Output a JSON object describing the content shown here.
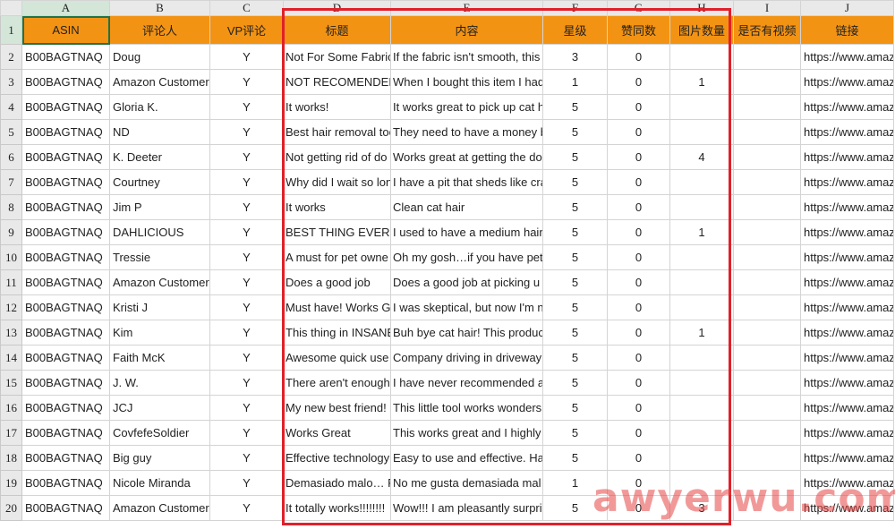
{
  "column_letters": [
    "A",
    "B",
    "C",
    "D",
    "E",
    "F",
    "G",
    "H",
    "I",
    "J"
  ],
  "headers": [
    "ASIN",
    "评论人",
    "VP评论",
    "标题",
    "内容",
    "星级",
    "赞同数",
    "图片数量",
    "是否有视频",
    "链接"
  ],
  "rows": [
    {
      "row": "2",
      "asin": "B00BAGTNAQ",
      "reviewer": "Doug",
      "vp": "Y",
      "title": "Not For Some Fabric",
      "content": "If the fabric isn't smooth, this",
      "stars": "3",
      "likes": "0",
      "images": "",
      "video": "",
      "link": "https://www.amaz"
    },
    {
      "row": "3",
      "asin": "B00BAGTNAQ",
      "reviewer": "Amazon Customer",
      "vp": "Y",
      "title": "NOT RECOMENDED",
      "content": "When I bought this item I had",
      "stars": "1",
      "likes": "0",
      "images": "1",
      "video": "",
      "link": "https://www.amaz"
    },
    {
      "row": "4",
      "asin": "B00BAGTNAQ",
      "reviewer": "Gloria K.",
      "vp": "Y",
      "title": "It works!",
      "content": "It works great to pick up cat h",
      "stars": "5",
      "likes": "0",
      "images": "",
      "video": "",
      "link": "https://www.amaz"
    },
    {
      "row": "5",
      "asin": "B00BAGTNAQ",
      "reviewer": "ND",
      "vp": "Y",
      "title": "Best hair removal too",
      "content": "They need to have a money b",
      "stars": "5",
      "likes": "0",
      "images": "",
      "video": "",
      "link": "https://www.amaz"
    },
    {
      "row": "6",
      "asin": "B00BAGTNAQ",
      "reviewer": "K. Deeter",
      "vp": "Y",
      "title": "Not getting rid of do",
      "content": "Works great at getting the do",
      "stars": "5",
      "likes": "0",
      "images": "4",
      "video": "",
      "link": "https://www.amaz"
    },
    {
      "row": "7",
      "asin": "B00BAGTNAQ",
      "reviewer": "Courtney",
      "vp": "Y",
      "title": "Why did I wait so lon",
      "content": "I have a pit that sheds like cra",
      "stars": "5",
      "likes": "0",
      "images": "",
      "video": "",
      "link": "https://www.amaz"
    },
    {
      "row": "8",
      "asin": "B00BAGTNAQ",
      "reviewer": "Jim P",
      "vp": "Y",
      "title": "It works",
      "content": "Clean cat hair",
      "stars": "5",
      "likes": "0",
      "images": "",
      "video": "",
      "link": "https://www.amaz"
    },
    {
      "row": "9",
      "asin": "B00BAGTNAQ",
      "reviewer": "DAHLICIOUS",
      "vp": "Y",
      "title": "BEST THING EVER &",
      "content": "I used to have a medium hair",
      "stars": "5",
      "likes": "0",
      "images": "1",
      "video": "",
      "link": "https://www.amaz"
    },
    {
      "row": "10",
      "asin": "B00BAGTNAQ",
      "reviewer": "Tressie",
      "vp": "Y",
      "title": "A must for pet owne",
      "content": "Oh my gosh…if you have pet",
      "stars": "5",
      "likes": "0",
      "images": "",
      "video": "",
      "link": "https://www.amaz"
    },
    {
      "row": "11",
      "asin": "B00BAGTNAQ",
      "reviewer": "Amazon Customer",
      "vp": "Y",
      "title": "Does a good job",
      "content": "Does a good job at picking u",
      "stars": "5",
      "likes": "0",
      "images": "",
      "video": "",
      "link": "https://www.amaz"
    },
    {
      "row": "12",
      "asin": "B00BAGTNAQ",
      "reviewer": "Kristi J",
      "vp": "Y",
      "title": "Must have! Works Gr",
      "content": "I was skeptical, but now I'm n",
      "stars": "5",
      "likes": "0",
      "images": "",
      "video": "",
      "link": "https://www.amaz"
    },
    {
      "row": "13",
      "asin": "B00BAGTNAQ",
      "reviewer": "Kim",
      "vp": "Y",
      "title": "This thing in INSANE",
      "content": "Buh bye cat hair! This produc",
      "stars": "5",
      "likes": "0",
      "images": "1",
      "video": "",
      "link": "https://www.amaz"
    },
    {
      "row": "14",
      "asin": "B00BAGTNAQ",
      "reviewer": "Faith McK",
      "vp": "Y",
      "title": "Awesome quick use",
      "content": "Company driving in driveway",
      "stars": "5",
      "likes": "0",
      "images": "",
      "video": "",
      "link": "https://www.amaz"
    },
    {
      "row": "15",
      "asin": "B00BAGTNAQ",
      "reviewer": "J. W.",
      "vp": "Y",
      "title": "There aren't enough",
      "content": "I have never recommended a",
      "stars": "5",
      "likes": "0",
      "images": "",
      "video": "",
      "link": "https://www.amaz"
    },
    {
      "row": "16",
      "asin": "B00BAGTNAQ",
      "reviewer": "JCJ",
      "vp": "Y",
      "title": "My new best friend!",
      "content": "This little tool works wonders",
      "stars": "5",
      "likes": "0",
      "images": "",
      "video": "",
      "link": "https://www.amaz"
    },
    {
      "row": "17",
      "asin": "B00BAGTNAQ",
      "reviewer": "CovfefeSoldier",
      "vp": "Y",
      "title": "Works Great",
      "content": "This works great and I highly",
      "stars": "5",
      "likes": "0",
      "images": "",
      "video": "",
      "link": "https://www.amaz"
    },
    {
      "row": "18",
      "asin": "B00BAGTNAQ",
      "reviewer": "Big guy",
      "vp": "Y",
      "title": "Effective technology",
      "content": "Easy to use and effective.  Ha",
      "stars": "5",
      "likes": "0",
      "images": "",
      "video": "",
      "link": "https://www.amaz"
    },
    {
      "row": "19",
      "asin": "B00BAGTNAQ",
      "reviewer": "Nicole Miranda",
      "vp": "Y",
      "title": "Demasiado malo… R",
      "content": "No me gusta demasiada mal",
      "stars": "1",
      "likes": "0",
      "images": "",
      "video": "",
      "link": "https://www.amaz"
    },
    {
      "row": "20",
      "asin": "B00BAGTNAQ",
      "reviewer": "Amazon Customer",
      "vp": "Y",
      "title": "It totally works!!!!!!!!",
      "content": "Wow!!! I am pleasantly surpri",
      "stars": "5",
      "likes": "0",
      "images": "3",
      "video": "",
      "link": "https://www.amaz"
    }
  ],
  "watermark": "awyerwu.com",
  "colors": {
    "header_fill": "#f39313",
    "highlight_frame": "#e0202a",
    "selection": "#217346"
  }
}
